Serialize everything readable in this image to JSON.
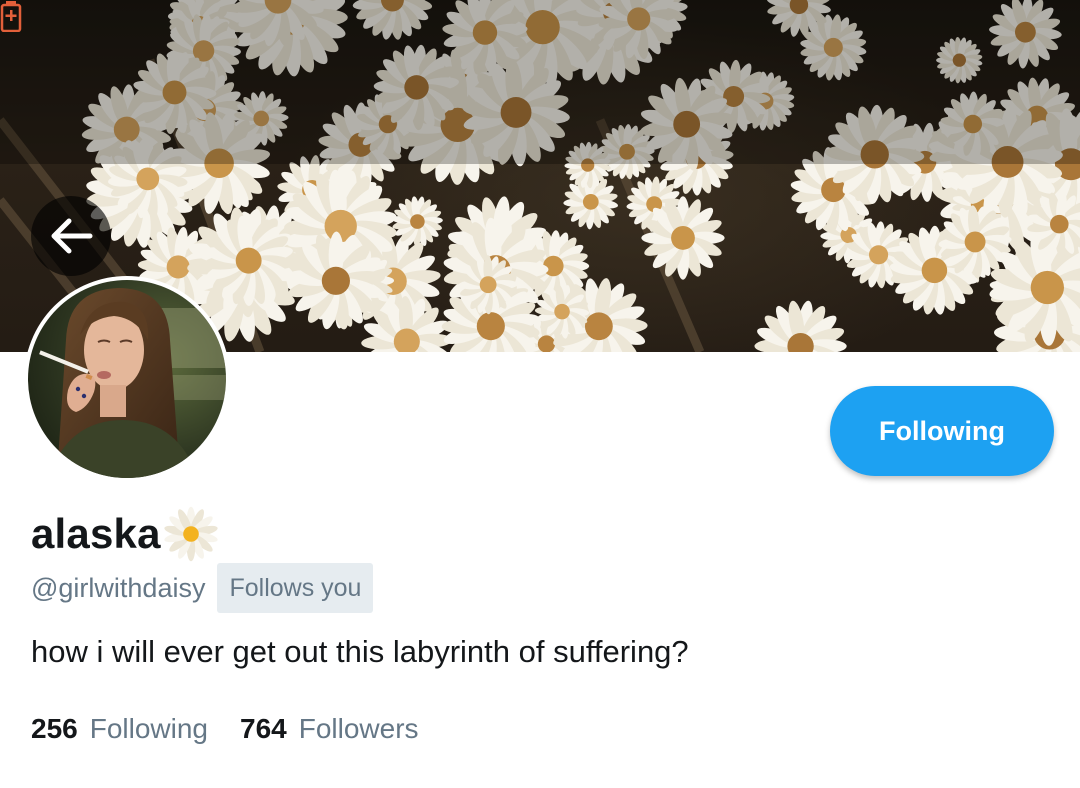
{
  "profile": {
    "display_name": "alaska",
    "name_emoji": "daisy-emoji",
    "handle": "@girlwithdaisy",
    "follows_you_badge": "Follows you",
    "bio": "how i will ever get out this labyrinth of suffering?",
    "follow_button_label": "Following",
    "following_count": "256",
    "following_label": "Following",
    "followers_count": "764",
    "followers_label": "Followers"
  },
  "header": {
    "back_icon": "arrow-left-icon",
    "status_icon": "battery-saver-icon",
    "banner": "daisy-flowers-photo"
  },
  "colors": {
    "accent": "#1da1f2",
    "secondary_text": "#657786",
    "primary_text": "#14171a",
    "badge_bg": "#e6ecf0",
    "battery_icon": "#e2603a"
  }
}
